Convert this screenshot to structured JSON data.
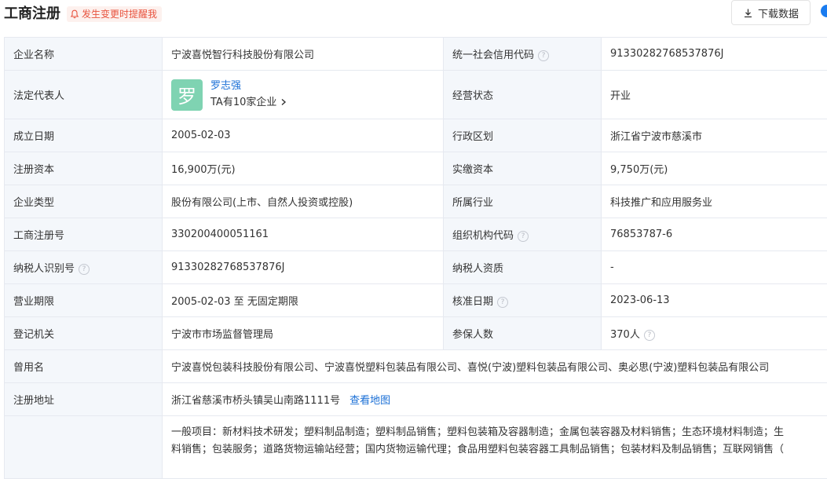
{
  "header": {
    "title": "工商注册",
    "notify_label": "发生变更时提醒我",
    "download_label": "下载数据"
  },
  "colors": {
    "accent_blue": "#1a6fd6",
    "notify_red": "#e8543f",
    "avatar_green": "#7fd3b2",
    "label_bg": "#f4f7fb"
  },
  "rows": {
    "r1": {
      "l1": "企业名称",
      "v1": "宁波喜悦智行科技股份有限公司",
      "l2": "统一社会信用代码",
      "v2": "91330282768537876J"
    },
    "r2": {
      "l1": "法定代表人",
      "avatar_char": "罗",
      "rep_name": "罗志强",
      "rep_sub": "TA有10家企业",
      "l2": "经营状态",
      "v2": "开业"
    },
    "r3": {
      "l1": "成立日期",
      "v1": "2005-02-03",
      "l2": "行政区划",
      "v2": "浙江省宁波市慈溪市"
    },
    "r4": {
      "l1": "注册资本",
      "v1": "16,900万(元)",
      "l2": "实缴资本",
      "v2": "9,750万(元)"
    },
    "r5": {
      "l1": "企业类型",
      "v1": "股份有限公司(上市、自然人投资或控股)",
      "l2": "所属行业",
      "v2": "科技推广和应用服务业"
    },
    "r6": {
      "l1": "工商注册号",
      "v1": "330200400051161",
      "l2": "组织机构代码",
      "v2": "76853787-6"
    },
    "r7": {
      "l1": "纳税人识别号",
      "v1": "91330282768537876J",
      "l2": "纳税人资质",
      "v2": "-"
    },
    "r8": {
      "l1": "营业期限",
      "v1": "2005-02-03 至 无固定期限",
      "l2": "核准日期",
      "v2": "2023-06-13"
    },
    "r9": {
      "l1": "登记机关",
      "v1": "宁波市市场监督管理局",
      "l2": "参保人数",
      "v2": "370人"
    },
    "r10": {
      "l1": "曾用名",
      "v1": "宁波喜悦包装科技股份有限公司、宁波喜悦塑料包装品有限公司、喜悦(宁波)塑料包装品有限公司、奥必思(宁波)塑料包装品有限公司"
    },
    "r11": {
      "l1": "注册地址",
      "v1": "浙江省慈溪市桥头镇吴山南路1111号",
      "map_link": "查看地图"
    },
    "r12": {
      "line1": "一般项目：新材料技术研发；塑料制品制造；塑料制品销售；塑料包装箱及容器制造；金属包装容器及材料销售；生态环境材料制造；生",
      "line2": "料销售；包装服务；道路货物运输站经营；国内货物运输代理；食品用塑料包装容器工具制品销售；包装材料及制品销售；互联网销售（"
    }
  }
}
